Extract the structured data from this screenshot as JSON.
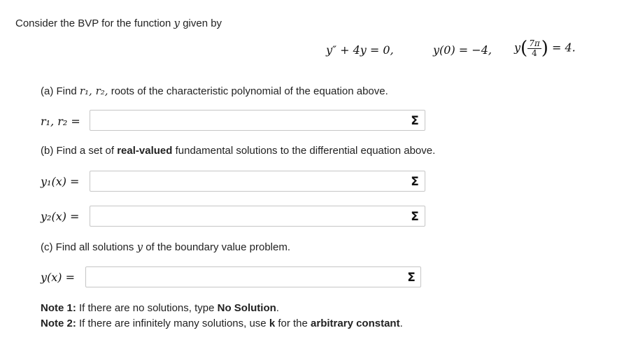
{
  "intro": {
    "text_before": "Consider the BVP for the function",
    "var": "y",
    "text_after": "given by"
  },
  "equation": {
    "ode": "y″ + 4y = 0,",
    "bc1": "y(0) = −4,",
    "bc2_func": "y",
    "bc2_num": "7π",
    "bc2_den": "4",
    "bc2_value": "= 4."
  },
  "part_a": {
    "prompt_before": "(a) Find",
    "vars": "r₁, r₂,",
    "prompt_after": "roots of the characteristic polynomial of the equation above.",
    "label": "r₁, r₂ =",
    "value": ""
  },
  "part_b": {
    "prompt_before": "(b) Find a set of",
    "prompt_bold": "real-valued",
    "prompt_after": "fundamental solutions to the differential equation above.",
    "y1_label": "y₁(x) =",
    "y1_value": "",
    "y2_label": "y₂(x) =",
    "y2_value": ""
  },
  "part_c": {
    "prompt_before": "(c) Find all solutions",
    "var": "y",
    "prompt_after": "of the boundary value problem.",
    "label": "y(x) =",
    "value": ""
  },
  "notes": {
    "note1_label": "Note 1:",
    "note1_text": "If there are no solutions, type",
    "note1_bold": "No Solution",
    "note1_end": ".",
    "note2_label": "Note 2:",
    "note2_text": "If there are infinitely many solutions, use",
    "note2_k": "k",
    "note2_mid": "for the",
    "note2_bold": "arbitrary constant",
    "note2_end": "."
  },
  "icons": {
    "sigma_glyph": "Σ"
  }
}
